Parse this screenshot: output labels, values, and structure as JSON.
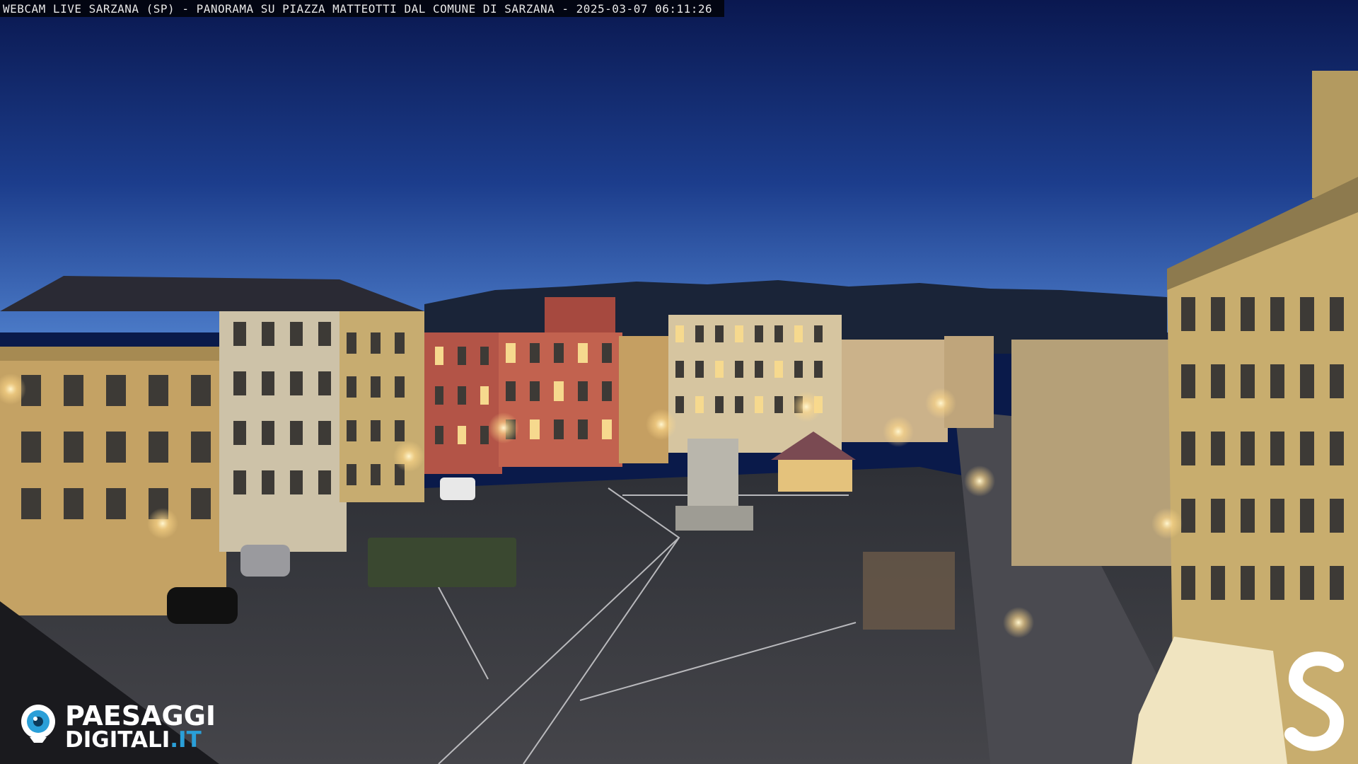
{
  "overlay": {
    "caption": "WEBCAM LIVE SARZANA (SP) - PANORAMA SU PIAZZA MATTEOTTI DAL COMUNE DI SARZANA - 2025-03-07  06:11:26"
  },
  "logo": {
    "line1": "PAESAGGI",
    "line2_main": "DIGITALI",
    "line2_tld": ".IT",
    "icon": "camera-eye-icon",
    "accent": "#2a9fd8"
  },
  "corner_logo": {
    "icon": "s-letter-logo"
  },
  "colors": {
    "sky_top": "#0b1a55",
    "sky_horizon": "#3b68b8",
    "pavement": "#3a3a40",
    "facade_yellow": "#c9a766",
    "facade_red": "#b9564a",
    "facade_cream": "#d8c7a2"
  }
}
